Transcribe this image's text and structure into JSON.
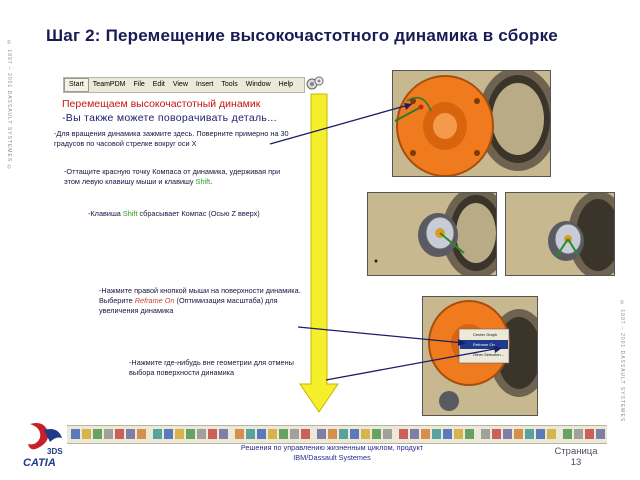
{
  "slide": {
    "title": "Шаг 2: Перемещение высокочастотного динамика в сборке",
    "left_strip": "© 1997 – 2001 DASSAULT SYSTEMES ©",
    "right_strip": "© 1997 – 2001 DASSAULT SYSTEMES"
  },
  "menu_bar": {
    "items": [
      "Start",
      "TeamPDM",
      "File",
      "Edit",
      "View",
      "Insert",
      "Tools",
      "Window",
      "Help"
    ]
  },
  "instructions": {
    "title": "Перемещаем высокочастотный динамик",
    "subtitle": "-Вы также можете поворачивать деталь...",
    "step1": "-Для вращения динамика зажмите здесь. Поверните примерно на 30 градусов по часовой стрелке вокруг оси X",
    "step2_a": "-Оттащите красную точку Компаса от динамика, удерживая при этом левую клавишу мыши и клавишу ",
    "step2_key": "Shift",
    "step2_b": ".",
    "step3_a": "-Клавиша ",
    "step3_key": "Shift",
    "step3_b": " сбрасывает Компас (Осью Z вверх)",
    "step4_a": "-Нажмите правой кнопкой мыши на поверхности динамика. Выберите ",
    "step4_cmd": "Reframe On",
    "step4_b": " (Оптимизация масштаба) для увеличения динамика",
    "step5": "-Нажмите где-нибудь вне геометрии для отмены выбора поверхности динамика"
  },
  "context_menu": {
    "items": [
      "Center Graph",
      "Reframe On",
      "Other Selection..."
    ]
  },
  "logo": {
    "name": "CATIA"
  },
  "footer": {
    "text": "Решения по управлению жизненным циклом, продукт IBM/Dassault Systemes",
    "page_label": "Страница",
    "page_number": "13"
  },
  "colors": {
    "title": "#1a1a55",
    "accent_red": "#c81414",
    "arrow_yellow": "#f4ef2a",
    "speaker_orange": "#f07a1e",
    "panel_wood": "#c8b890"
  },
  "icons": [
    "gears-icon",
    "arrow-down-icon",
    "catia-logo-icon",
    "toolbar-icons"
  ]
}
